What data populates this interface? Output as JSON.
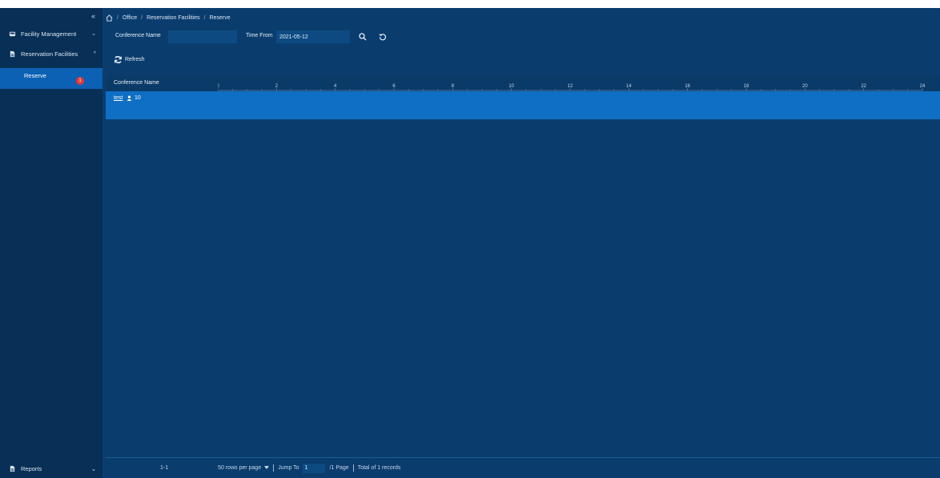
{
  "sidebar": {
    "collapse_glyph": "«",
    "items": [
      {
        "label": "Facility Management",
        "icon": "facility-icon",
        "chevron": "⌄"
      },
      {
        "label": "Reservation Facilities",
        "icon": "document-icon",
        "chevron": "^"
      }
    ],
    "sub_item": {
      "label": "Reserve",
      "badge": "1"
    },
    "reports": {
      "label": "Reports",
      "icon": "document-icon",
      "chevron": "⌄"
    }
  },
  "breadcrumb": {
    "sep": "/",
    "office": "Office",
    "reservation": "Reservation Facilities",
    "current": "Reserve"
  },
  "filters": {
    "conference_label": "Conference Name",
    "conference_value": "",
    "time_label": "Time From",
    "time_value": "2021-05-12"
  },
  "toolbar": {
    "refresh_label": "Refresh"
  },
  "table": {
    "column": "Conference Name",
    "hours": [
      "0",
      "2",
      "4",
      "6",
      "8",
      "10",
      "12",
      "14",
      "16",
      "18",
      "20",
      "22",
      "24"
    ],
    "rows": [
      {
        "name": "test",
        "capacity": "10"
      }
    ]
  },
  "pagination": {
    "range": "1-1",
    "rows_per_page": "50 rows per page",
    "jump_label": "Jump To",
    "jump_value": "1",
    "page_suffix": "/1 Page",
    "total": "Total of 1 records"
  },
  "colors": {
    "bg": "#0a3d6e",
    "sidebar": "#082f55",
    "accent": "#0c61b5",
    "row": "#0e6fc4",
    "badge": "#e53935"
  }
}
